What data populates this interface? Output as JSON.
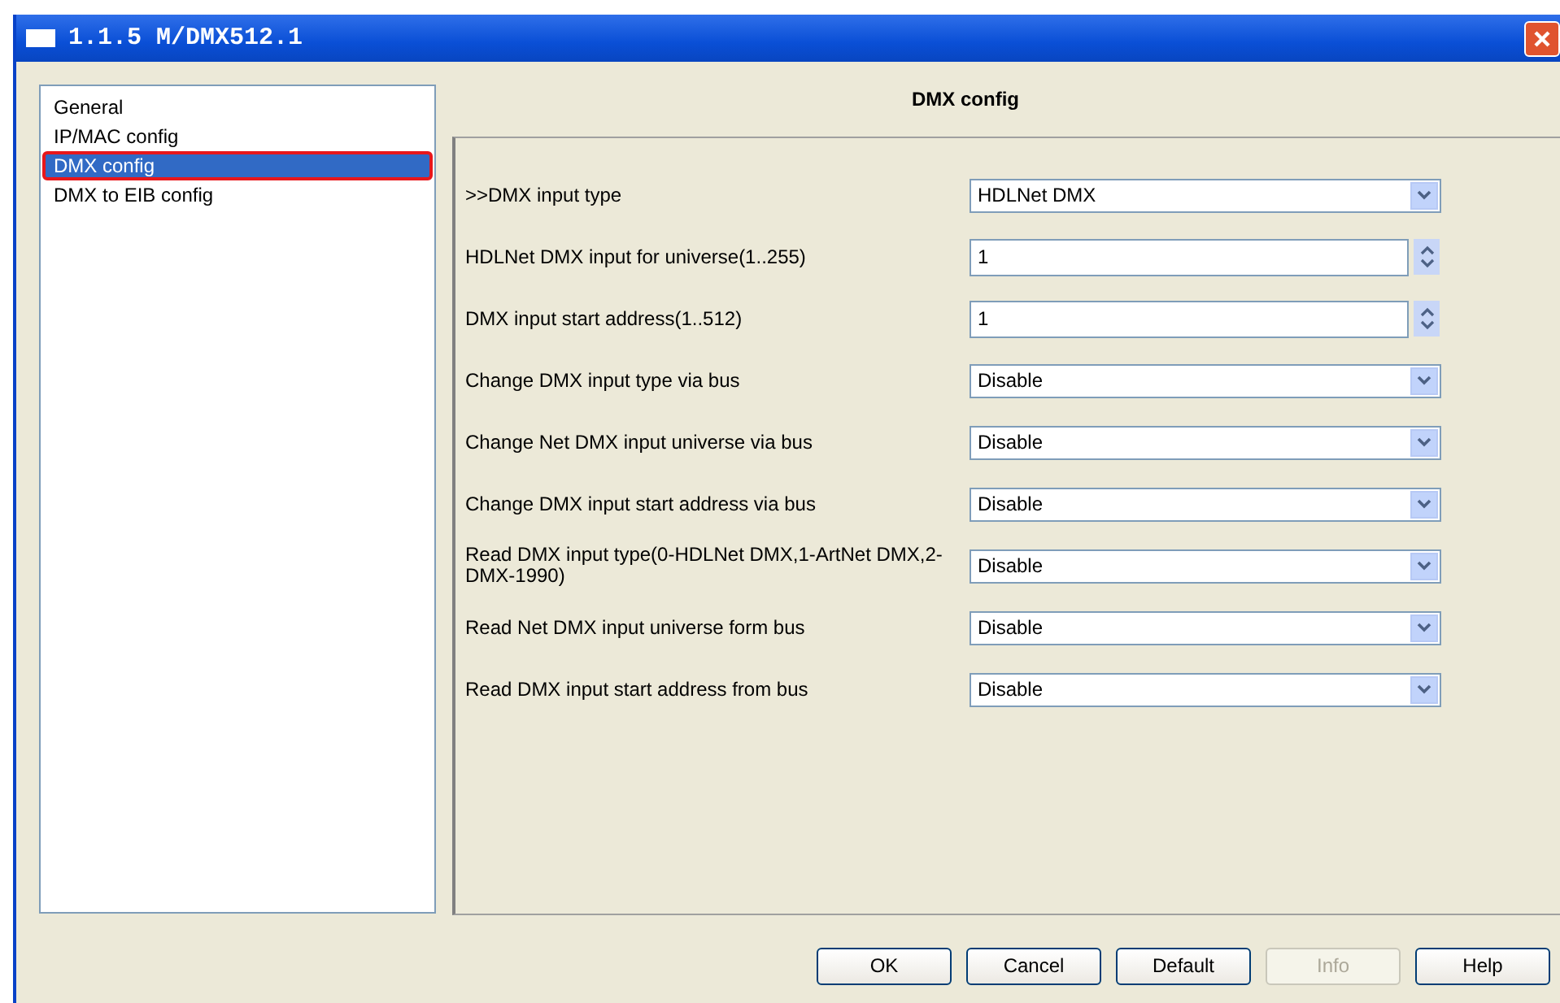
{
  "window": {
    "title": "1.1.5 M/DMX512.1"
  },
  "sidebar": {
    "items": [
      {
        "label": "General",
        "selected": false
      },
      {
        "label": "IP/MAC config",
        "selected": false
      },
      {
        "label": "DMX config",
        "selected": true
      },
      {
        "label": "DMX to EIB config",
        "selected": false
      }
    ]
  },
  "panel": {
    "title": "DMX config",
    "rows": [
      {
        "label": ">>DMX input type",
        "kind": "select",
        "value": "HDLNet DMX"
      },
      {
        "label": "HDLNet DMX input for universe(1..255)",
        "kind": "spin",
        "value": "1"
      },
      {
        "label": "DMX input start address(1..512)",
        "kind": "spin",
        "value": "1"
      },
      {
        "label": "Change DMX input type via bus",
        "kind": "select",
        "value": "Disable"
      },
      {
        "label": "Change Net DMX input universe via bus",
        "kind": "select",
        "value": "Disable"
      },
      {
        "label": "Change DMX input start address via bus",
        "kind": "select",
        "value": "Disable"
      },
      {
        "label": "Read DMX input type(0-HDLNet DMX,1-ArtNet DMX,2- DMX-1990)",
        "kind": "select",
        "value": "Disable"
      },
      {
        "label": "Read Net DMX input universe form bus",
        "kind": "select",
        "value": "Disable"
      },
      {
        "label": "Read DMX input start address from bus",
        "kind": "select",
        "value": "Disable"
      }
    ]
  },
  "buttons": [
    {
      "label": "OK",
      "disabled": false
    },
    {
      "label": "Cancel",
      "disabled": false
    },
    {
      "label": "Default",
      "disabled": false
    },
    {
      "label": "Info",
      "disabled": true
    },
    {
      "label": "Help",
      "disabled": false
    }
  ]
}
